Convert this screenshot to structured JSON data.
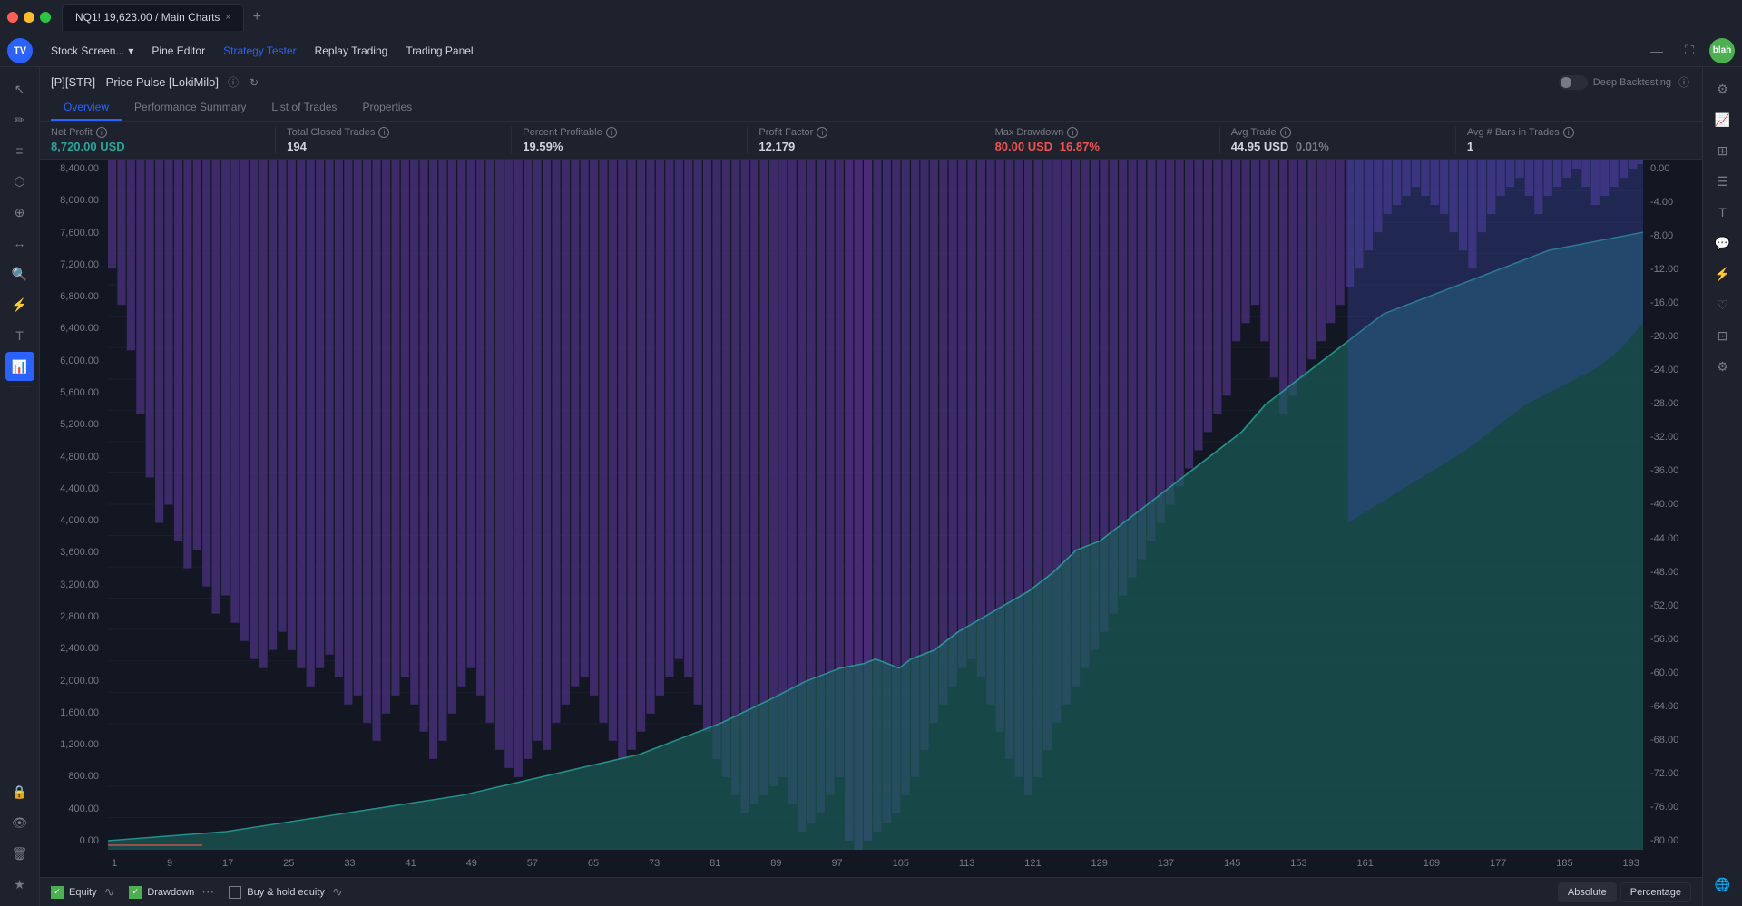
{
  "titlebar": {
    "tab_title": "NQ1! 19,623.00 / Main Charts",
    "close_icon": "×",
    "plus_icon": "+"
  },
  "topnav": {
    "brand": "TV",
    "items": [
      {
        "label": "Stock Screen...",
        "has_dropdown": true,
        "active": false
      },
      {
        "label": "Pine Editor",
        "active": false
      },
      {
        "label": "Strategy Tester",
        "active": true
      },
      {
        "label": "Replay Trading",
        "active": false
      },
      {
        "label": "Trading Panel",
        "active": false
      }
    ],
    "right": {
      "minimize": "—",
      "maximize": "⛶",
      "user": "blah"
    }
  },
  "panel": {
    "title": "[P][STR] - Price Pulse [LokiMilo]",
    "deep_backtesting_label": "Deep Backtesting",
    "tabs": [
      {
        "label": "Overview",
        "active": true
      },
      {
        "label": "Performance Summary",
        "active": false
      },
      {
        "label": "List of Trades",
        "active": false
      },
      {
        "label": "Properties",
        "active": false
      }
    ]
  },
  "stats": [
    {
      "label": "Net Profit",
      "value": "8,720.00 USD",
      "value_class": "positive"
    },
    {
      "label": "Total Closed Trades",
      "value": "194",
      "value_class": ""
    },
    {
      "label": "Percent Profitable",
      "value": "19.59%",
      "value_class": ""
    },
    {
      "label": "Profit Factor",
      "value": "12.179",
      "value_class": ""
    },
    {
      "label": "Max Drawdown",
      "value": "80.00 USD",
      "value_secondary": "16.87%",
      "value_class": "red"
    },
    {
      "label": "Avg Trade",
      "value": "44.95 USD",
      "value_secondary": "0.01%",
      "value_class": ""
    },
    {
      "label": "Avg # Bars in Trades",
      "value": "1",
      "value_class": ""
    }
  ],
  "chart": {
    "y_labels_left": [
      "8,400.00",
      "8,000.00",
      "7,600.00",
      "7,200.00",
      "6,800.00",
      "6,400.00",
      "6,000.00",
      "5,600.00",
      "5,200.00",
      "4,800.00",
      "4,400.00",
      "4,000.00",
      "3,600.00",
      "3,200.00",
      "2,800.00",
      "2,400.00",
      "2,000.00",
      "1,600.00",
      "1,200.00",
      "800.00",
      "400.00",
      "0.00"
    ],
    "y_labels_right": [
      "0.00",
      "-4.00",
      "-8.00",
      "-12.00",
      "-16.00",
      "-20.00",
      "-24.00",
      "-28.00",
      "-32.00",
      "-36.00",
      "-40.00",
      "-44.00",
      "-48.00",
      "-52.00",
      "-56.00",
      "-60.00",
      "-64.00",
      "-68.00",
      "-72.00",
      "-76.00",
      "-80.00"
    ],
    "x_labels": [
      "1",
      "9",
      "17",
      "25",
      "33",
      "41",
      "49",
      "57",
      "65",
      "73",
      "81",
      "89",
      "97",
      "105",
      "113",
      "121",
      "129",
      "137",
      "145",
      "153",
      "161",
      "169",
      "177",
      "185",
      "193"
    ]
  },
  "legend": {
    "items": [
      {
        "label": "Equity",
        "checked": true,
        "color": "#4caf50",
        "icon": "∿"
      },
      {
        "label": "Drawdown",
        "checked": true,
        "color": "#4caf50",
        "icon": "⋯"
      },
      {
        "label": "Buy & hold equity",
        "checked": false,
        "color": "#787b86",
        "icon": "∿"
      }
    ],
    "buttons": [
      {
        "label": "Absolute",
        "active": true
      },
      {
        "label": "Percentage",
        "active": false
      }
    ]
  },
  "sidebar_icons": {
    "top": [
      "✏️",
      "≡",
      "⊕",
      "×",
      "T",
      "⭐",
      "🔍",
      "⚡"
    ],
    "bottom": [
      "🔒",
      "👁",
      "🗑"
    ]
  }
}
